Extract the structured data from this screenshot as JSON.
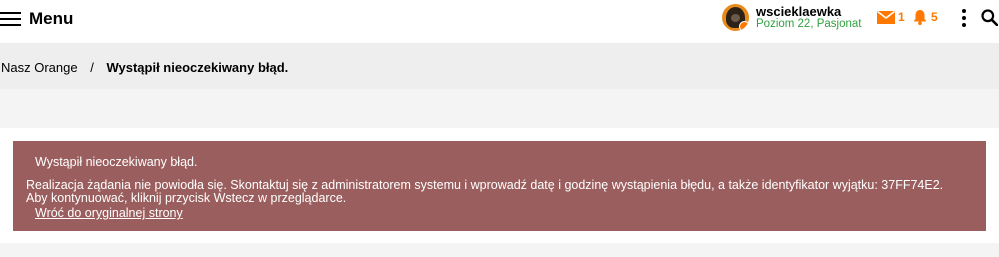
{
  "header": {
    "menu_label": "Menu",
    "user": {
      "name": "wscieklaewka",
      "level": "Poziom 22, Pasjonat"
    },
    "messages_count": "1",
    "notifications_count": "5",
    "icons": [
      "hamburger-icon",
      "avatar",
      "mail-icon",
      "bell-icon",
      "more-vertical-icon",
      "search-icon"
    ],
    "colors": {
      "accent": "#ff7900",
      "level_green": "#32a041"
    }
  },
  "breadcrumb": {
    "home": "Nasz Orange",
    "separator": "/",
    "current": "Wystąpił nieoczekiwany błąd."
  },
  "error": {
    "title": "Wystąpił nieoczekiwany błąd.",
    "message_line1": "Realizacja żądania nie powiodła się. Skontaktuj się z administratorem systemu i wprowadź datę i godzinę wystąpienia błędu, a także identyfikator wyjątku: 37FF74E2.",
    "message_line2": "Aby kontynuować, kliknij przycisk Wstecz w przeglądarce.",
    "link": "Wróć do oryginalnej strony",
    "background_color": "#9b5e5e"
  }
}
